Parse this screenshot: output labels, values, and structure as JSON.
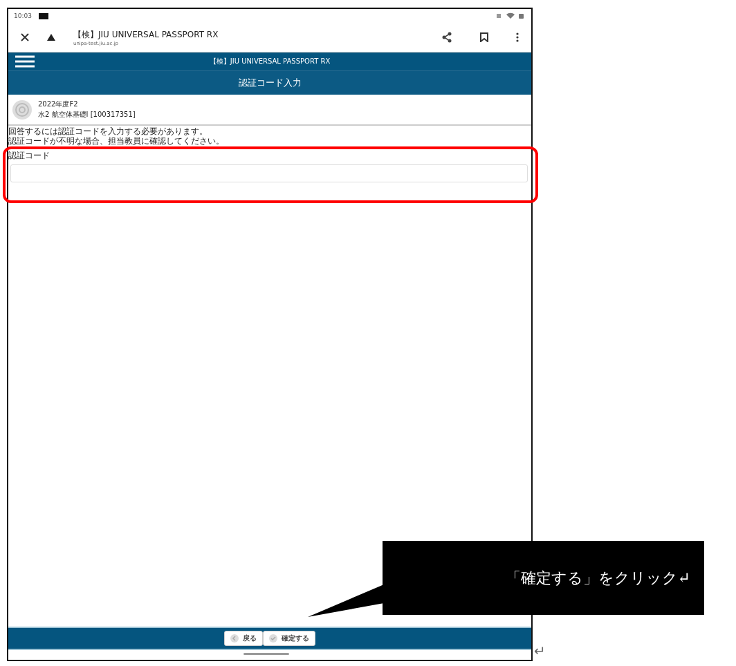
{
  "status_bar": {
    "time": "10:03"
  },
  "browser_bar": {
    "title": "【検】JIU UNIVERSAL PASSPORT RX",
    "url": "unipa-test.jiu.ac.jp"
  },
  "app_header": {
    "title": "【検】JIU UNIVERSAL PASSPORT RX"
  },
  "page_title": "認証コード入力",
  "course": {
    "term": "2022年度F2",
    "name": "水2 航空体基礎Ⅰ [100317351]"
  },
  "notice": [
    "回答するには認証コードを入力する必要があります。",
    "認証コードが不明な場合、担当教員に確認してください。"
  ],
  "code_field": {
    "label": "認証コード"
  },
  "footer_buttons": [
    {
      "label": "戻る",
      "kind": "back"
    },
    {
      "label": "確定する",
      "kind": "confirm"
    }
  ],
  "callout": {
    "text": "「確定する」をクリック↵"
  },
  "paragraph_mark": "↵"
}
